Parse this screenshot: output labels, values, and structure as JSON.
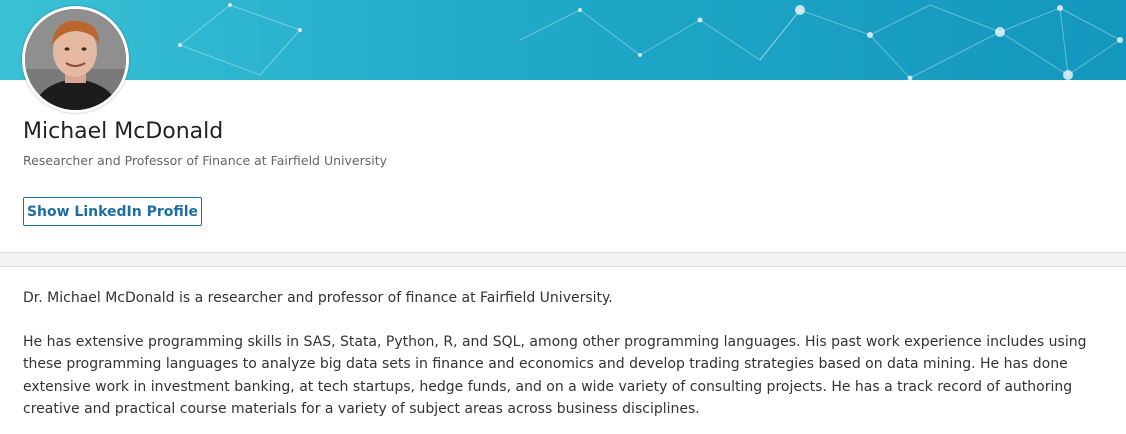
{
  "profile": {
    "name": "Michael McDonald",
    "headline": "Researcher and Professor of Finance at Fairfield University",
    "linkedin_button_label": "Show LinkedIn Profile",
    "avatar_icon": "profile-photo"
  },
  "about": {
    "paragraph_1": "Dr. Michael McDonald is a researcher and professor of finance at Fairfield University.",
    "paragraph_2": "He has extensive programming skills in SAS, Stata, Python, R, and SQL, among other programming languages. His past work experience includes using these programming languages to analyze big data sets in finance and economics and develop trading strategies based on data mining. He has done extensive work in investment banking, at tech startups, hedge funds, and on a wide variety of consulting projects. He has a track record of authoring creative and practical course materials for a variety of subject areas across business disciplines."
  },
  "colors": {
    "banner_start": "#3ac1d6",
    "banner_end": "#1497be",
    "button_accent": "#1c6ea4"
  }
}
